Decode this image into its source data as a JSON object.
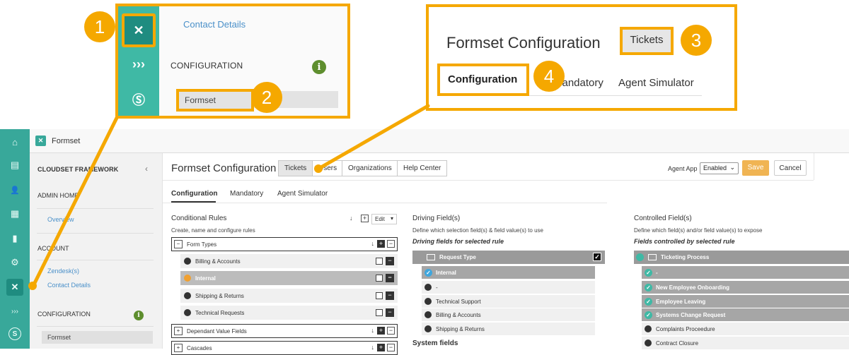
{
  "callout1": {
    "contact_details": "Contact Details",
    "configuration": "CONFIGURATION",
    "info_glyph": "i",
    "formset": "Formset"
  },
  "callout2": {
    "title": "Formset Configuration",
    "tickets": "Tickets",
    "configuration": "Configuration",
    "mandatory": "Mandatory",
    "agent_simulator": "Agent Simulator"
  },
  "badges": [
    "1",
    "2",
    "3",
    "4"
  ],
  "accent_color": "#f5a800",
  "iconbar": {
    "icons": [
      "home-icon",
      "inbox-icon",
      "users-icon",
      "building-icon",
      "chart-icon",
      "gear-icon",
      "cloudset-icon",
      "arrows-icon",
      "s-icon"
    ],
    "glyphs": [
      "⌂",
      "▤",
      "👤",
      "▦",
      "▮",
      "⚙",
      "✕",
      "›››",
      "S"
    ]
  },
  "topbar": {
    "title": "Formset"
  },
  "leftnav": {
    "framework": "CLOUDSET FRAMEWORK",
    "chevron": "‹",
    "admin_home": "ADMIN HOME",
    "overview": "Overview",
    "account": "ACCOUNT",
    "zendesk": "Zendesk(s)",
    "contact_details": "Contact Details",
    "configuration": "CONFIGURATION",
    "info_glyph": "i",
    "formset": "Formset"
  },
  "main": {
    "title": "Formset Configuration",
    "segments": [
      "Tickets",
      "Users",
      "Organizations",
      "Help Center"
    ],
    "agent_app_label": "Agent App",
    "agent_app_value": "Enabled",
    "save": "Save",
    "cancel": "Cancel",
    "subtabs": [
      "Configuration",
      "Mandatory",
      "Agent Simulator"
    ]
  },
  "conditional_rules": {
    "title": "Conditional Rules",
    "subtitle": "Create, name and configure rules",
    "sort_glyph": "↓",
    "plus_glyph": "+",
    "edit": "Edit",
    "minus_glyph": "−",
    "groups": [
      {
        "label": "Form Types",
        "toggle": "−"
      },
      {
        "label": "Dependant Value Fields",
        "toggle": "+"
      },
      {
        "label": "Cascades",
        "toggle": "+"
      }
    ],
    "rules": [
      {
        "label": "Billing & Accounts",
        "selected": false
      },
      {
        "label": "Internal",
        "selected": true
      },
      {
        "label": "Shipping & Returns",
        "selected": false
      },
      {
        "label": "Technical Requests",
        "selected": false
      }
    ]
  },
  "driving_fields": {
    "title": "Driving Field(s)",
    "subtitle": "Define which selection field(s) & field value(s) to use",
    "section": "Driving fields for selected rule",
    "field": "Request Type",
    "check_glyph": "✓",
    "values": [
      {
        "label": "Internal",
        "selected": true
      },
      {
        "label": "-",
        "selected": false
      },
      {
        "label": "Technical Support",
        "selected": false
      },
      {
        "label": "Billing & Accounts",
        "selected": false
      },
      {
        "label": "Shipping & Returns",
        "selected": false
      }
    ],
    "system_fields": "System fields"
  },
  "controlled_fields": {
    "title": "Controlled Field(s)",
    "subtitle": "Define which field(s) and/or field value(s) to expose",
    "section": "Fields controlled by selected rule",
    "field": "Ticketing Process",
    "check_glyph": "✓",
    "values": [
      {
        "label": "-",
        "selected": true
      },
      {
        "label": "New Employee Onboarding",
        "selected": true
      },
      {
        "label": "Employee Leaving",
        "selected": true
      },
      {
        "label": "Systems Change Request",
        "selected": true
      },
      {
        "label": "Complaints Proceedure",
        "selected": false
      },
      {
        "label": "Contract Closure",
        "selected": false
      }
    ]
  }
}
